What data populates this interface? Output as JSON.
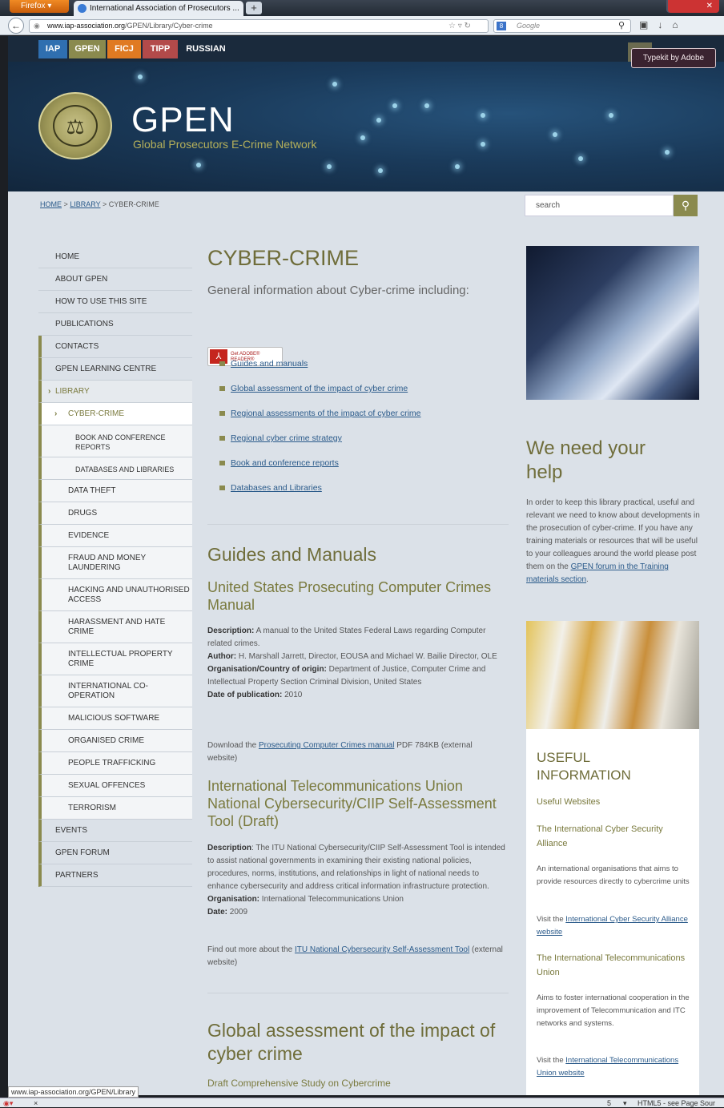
{
  "browser": {
    "menu_button": "Firefox",
    "tab_title": "International Association of Prosecutors ...",
    "new_tab": "+",
    "url_host": "www.iap-association.org",
    "url_path": "/GPEN/Library/Cyber-crime",
    "search_placeholder": "Google",
    "status_url": "www.iap-association.org/GPEN/Library",
    "status_right": "HTML5 - see Page Sour",
    "status_count": "5",
    "status_close": "×"
  },
  "topnav": [
    "IAP",
    "GPEN",
    "FICJ",
    "TIPP",
    "RUSSIAN"
  ],
  "topnav_colors": [
    "#2f6fb0",
    "#8a8a4e",
    "#e07a22",
    "#b34a4a",
    "#1a2a3c"
  ],
  "typekit": "Typekit by Adobe",
  "banner": {
    "title": "GPEN",
    "subtitle": "Global Prosecutors E-Crime Network"
  },
  "breadcrumb": {
    "home": "HOME",
    "sep": ">",
    "library": "LIBRARY",
    "current": "CYBER-CRIME"
  },
  "search": {
    "placeholder": "search"
  },
  "leftnav": {
    "home": "HOME",
    "about": "ABOUT GPEN",
    "howto": "HOW TO USE THIS SITE",
    "publications": "PUBLICATIONS",
    "contacts": "CONTACTS",
    "learning": "GPEN LEARNING CENTRE",
    "library": "LIBRARY",
    "cybercrime": "CYBER-CRIME",
    "book": "BOOK AND CONFERENCE REPORTS",
    "databases": "DATABASES AND LIBRARIES",
    "datatheft": "DATA THEFT",
    "drugs": "DRUGS",
    "evidence": "EVIDENCE",
    "fraud": "FRAUD AND MONEY LAUNDERING",
    "hacking": "HACKING AND UNAUTHORISED ACCESS",
    "harassment": "HARASSMENT AND HATE CRIME",
    "ip": "INTELLECTUAL PROPERTY CRIME",
    "intl": "INTERNATIONAL CO-OPERATION",
    "malicious": "MALICIOUS SOFTWARE",
    "organised": "ORGANISED CRIME",
    "trafficking": "PEOPLE TRAFFICKING",
    "sexual": "SEXUAL OFFENCES",
    "terrorism": "TERRORISM",
    "events": "EVENTS",
    "forum": "GPEN FORUM",
    "partners": "PARTNERS"
  },
  "main": {
    "title": "CYBER-CRIME",
    "intro": "General information about Cyber-crime including:",
    "adobe": "Get ADOBE® READER®",
    "links": [
      "Guides and manuals",
      "Global assessment of the impact of cyber crime",
      "Regional assessments of the impact of cyber crime",
      "Regional cyber crime strategy",
      "Book and conference reports",
      "Databases and Libraries"
    ],
    "guides_h": "Guides and Manuals",
    "us_h": "United States Prosecuting Computer Crimes Manual",
    "us_desc_l": "Description:",
    "us_desc": "A manual to the United States Federal Laws regarding Computer related crimes.",
    "us_author_l": "Author:",
    "us_author": "H. Marshall Jarrett, Director, EOUSA and Michael W. Bailie Director, OLE",
    "us_org_l": "Organisation/Country of origin:",
    "us_org": "Department of Justice, Computer Crime and Intellectual Property Section Criminal Division, United States",
    "us_date_l": "Date of publication:",
    "us_date": "2010",
    "us_dl_pre": "Download the",
    "us_dl_link": "Prosecuting Computer Crimes manual",
    "us_dl_post": "PDF 784KB (external website)",
    "itu_h": "International Telecommunications Union National Cybersecurity/CIIP Self-Assessment Tool (Draft)",
    "itu_desc_l": "Description",
    "itu_desc": ": The ITU National Cybersecurity/CIIP Self-Assessment Tool is intended to assist national governments in examining their existing national policies, procedures, norms, institutions, and relationships in light of national needs to enhance cybersecurity and address critical information infrastructure protection.",
    "itu_org_l": "Organisation:",
    "itu_org": "International Telecommunications Union",
    "itu_date_l": "Date:",
    "itu_date": "2009",
    "itu_more_pre": "Find out more about the",
    "itu_more_link": "ITU National Cybersecurity Self-Assessment Tool",
    "itu_more_post": "(external website)",
    "global_h": "Global assessment of the impact of cyber crime",
    "draft": "Draft Comprehensive Study on Cybercrime"
  },
  "help": {
    "title": "We need your help",
    "text": "In order to keep this library practical, useful and relevant we need to know about developments in the prosecution of cyber-crime. If you have any training materials or resources that will be useful to your colleagues around the world please post them on the",
    "link": "GPEN forum in the Training materials section",
    "end": "."
  },
  "useful": {
    "title": "USEFUL INFORMATION",
    "websites": "Useful Websites",
    "icsa_h": "The International Cyber Security Alliance",
    "icsa_p": "An international organisations that aims to provide resources directly to cybercrime units",
    "icsa_visit": "Visit the",
    "icsa_link": "International Cyber Security Alliance website",
    "itu_h": "The International Telecommunications Union",
    "itu_p": "Aims to foster international cooperation in the improvement of Telecommunication and ITC networks and systems.",
    "itu_visit": "Visit the",
    "itu_link": "International Telecommunications Union website"
  }
}
